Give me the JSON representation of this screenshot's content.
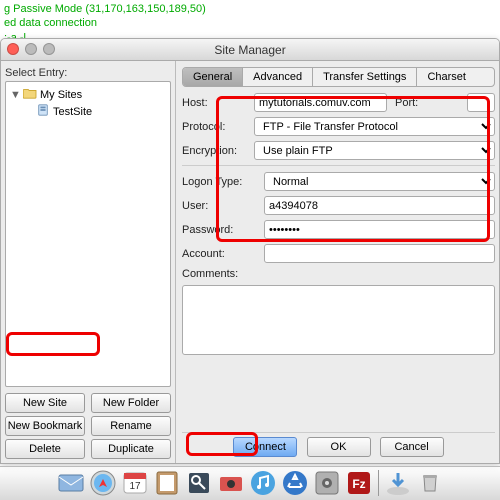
{
  "terminal": {
    "line1": "g Passive Mode (31,170,163,150,189,50)",
    "line2": "ed data connection",
    "line3": ":-a -l"
  },
  "window": {
    "title": "Site Manager"
  },
  "left": {
    "label": "Select Entry:",
    "root": "My Sites",
    "site": "TestSite",
    "buttons": {
      "newSite": "New Site",
      "newFolder": "New Folder",
      "newBookmark": "New Bookmark",
      "rename": "Rename",
      "delete": "Delete",
      "duplicate": "Duplicate"
    }
  },
  "tabs": {
    "general": "General",
    "advanced": "Advanced",
    "transfer": "Transfer Settings",
    "charset": "Charset"
  },
  "form": {
    "hostLabel": "Host:",
    "hostValue": "mytutorials.comuv.com",
    "portLabel": "Port:",
    "portValue": "",
    "protocolLabel": "Protocol:",
    "protocolValue": "FTP - File Transfer Protocol",
    "encryptionLabel": "Encryption:",
    "encryptionValue": "Use plain FTP",
    "logonLabel": "Logon Type:",
    "logonValue": "Normal",
    "userLabel": "User:",
    "userValue": "a4394078",
    "passwordLabel": "Password:",
    "passwordValue": "••••••••",
    "accountLabel": "Account:",
    "accountValue": "",
    "commentsLabel": "Comments:",
    "commentsValue": ""
  },
  "bottom": {
    "connect": "Connect",
    "ok": "OK",
    "cancel": "Cancel"
  }
}
